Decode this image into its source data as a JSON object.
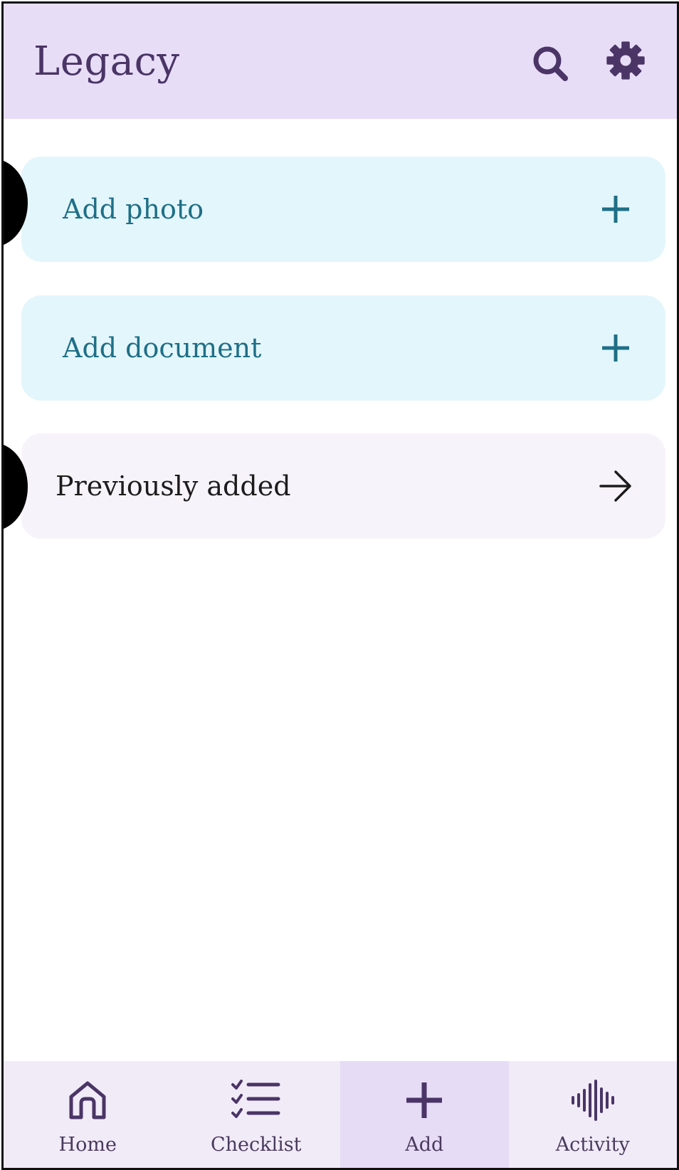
{
  "app_bar": {
    "title": "Legacy",
    "search_icon": "search-icon",
    "settings_icon": "gear-icon"
  },
  "actions": [
    {
      "label": "Add photo",
      "icon": "plus-icon"
    },
    {
      "label": "Add document",
      "icon": "plus-icon"
    }
  ],
  "previously_added": {
    "label": "Previously added",
    "icon": "arrow-right-icon"
  },
  "bottom_nav": {
    "items": [
      {
        "label": "Home",
        "icon": "home-icon",
        "active": false
      },
      {
        "label": "Checklist",
        "icon": "checklist-icon",
        "active": false
      },
      {
        "label": "Add",
        "icon": "plus-icon",
        "active": true
      },
      {
        "label": "Activity",
        "icon": "audio-wave-icon",
        "active": false
      }
    ]
  },
  "colors": {
    "app_bar_bg": "#e8ddf7",
    "primary_purple": "#4a3566",
    "teal_text": "#1e6f86",
    "action_card_bg": "#e3f6fc",
    "prev_card_bg": "#f7f3fb",
    "nav_bg": "#f1ebf8",
    "nav_active_bg": "#e6dcf6"
  }
}
